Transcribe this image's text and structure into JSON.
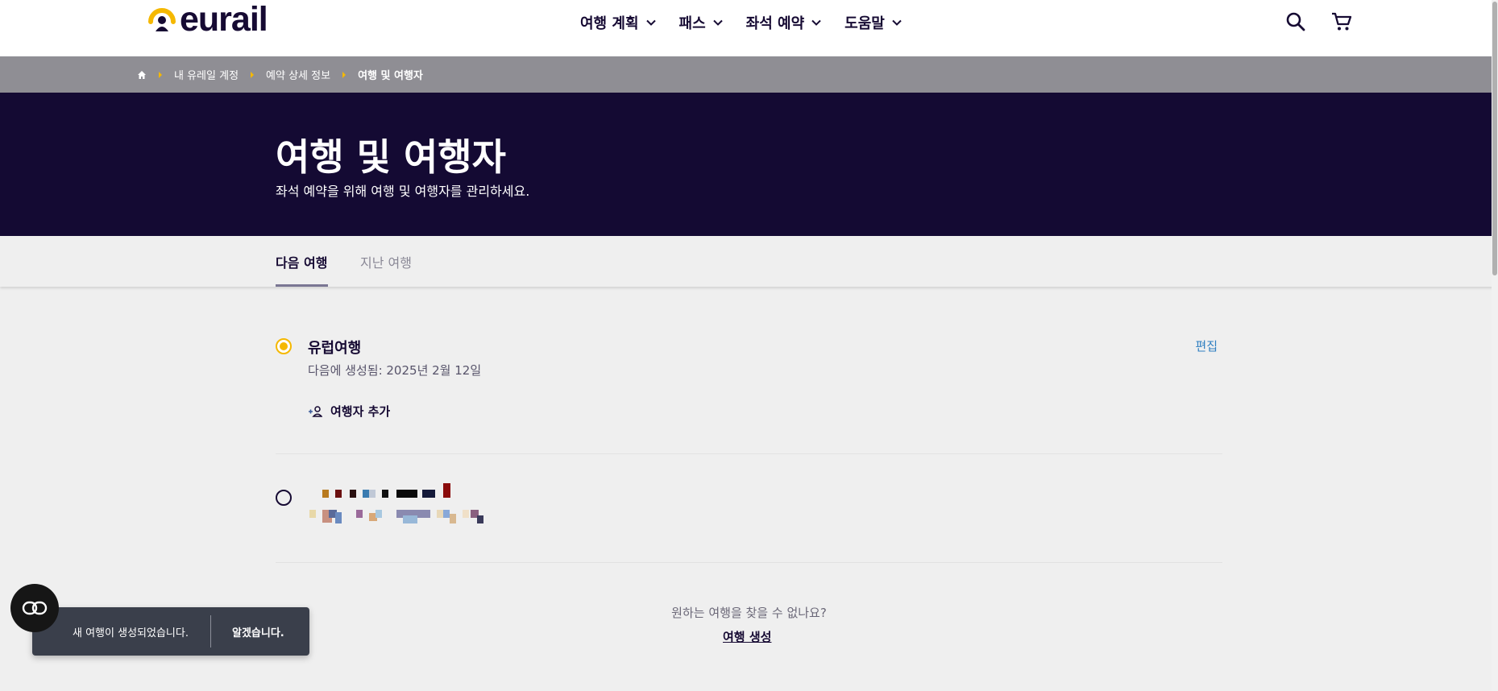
{
  "header": {
    "logo_text": "eurail",
    "nav": [
      {
        "label": "여행 계획"
      },
      {
        "label": "패스"
      },
      {
        "label": "좌석 예약"
      },
      {
        "label": "도움말"
      }
    ],
    "icons": [
      "search-icon",
      "cart-icon"
    ]
  },
  "breadcrumb": {
    "items": [
      "내 유레일 계정",
      "예약 상세 정보",
      "여행 및 여행자"
    ]
  },
  "hero": {
    "title": "여행 및 여행자",
    "subtitle": "좌석 예약을 위해 여행 및 여행자를 관리하세요."
  },
  "tabs": [
    {
      "label": "다음 여행",
      "active": true
    },
    {
      "label": "지난 여행",
      "active": false
    }
  ],
  "trips": [
    {
      "title": "유럽여행",
      "created": "다음에 생성됨: 2025년 2월 12일",
      "edit_label": "편집",
      "add_traveler_label": "여행자 추가",
      "selected": true
    },
    {
      "selected": false,
      "redacted": true
    }
  ],
  "cta": {
    "question": "원하는 여행을 찾을 수 없나요?",
    "link": "여행 생성"
  },
  "toast": {
    "message": "새 여행이 생성되었습니다.",
    "button": "알겠습니다."
  },
  "colors": {
    "brand_navy": "#140a33",
    "accent_yellow": "#f5b800",
    "breadcrumb_bg": "#8f8e94",
    "link_blue": "#2f7fc1"
  }
}
